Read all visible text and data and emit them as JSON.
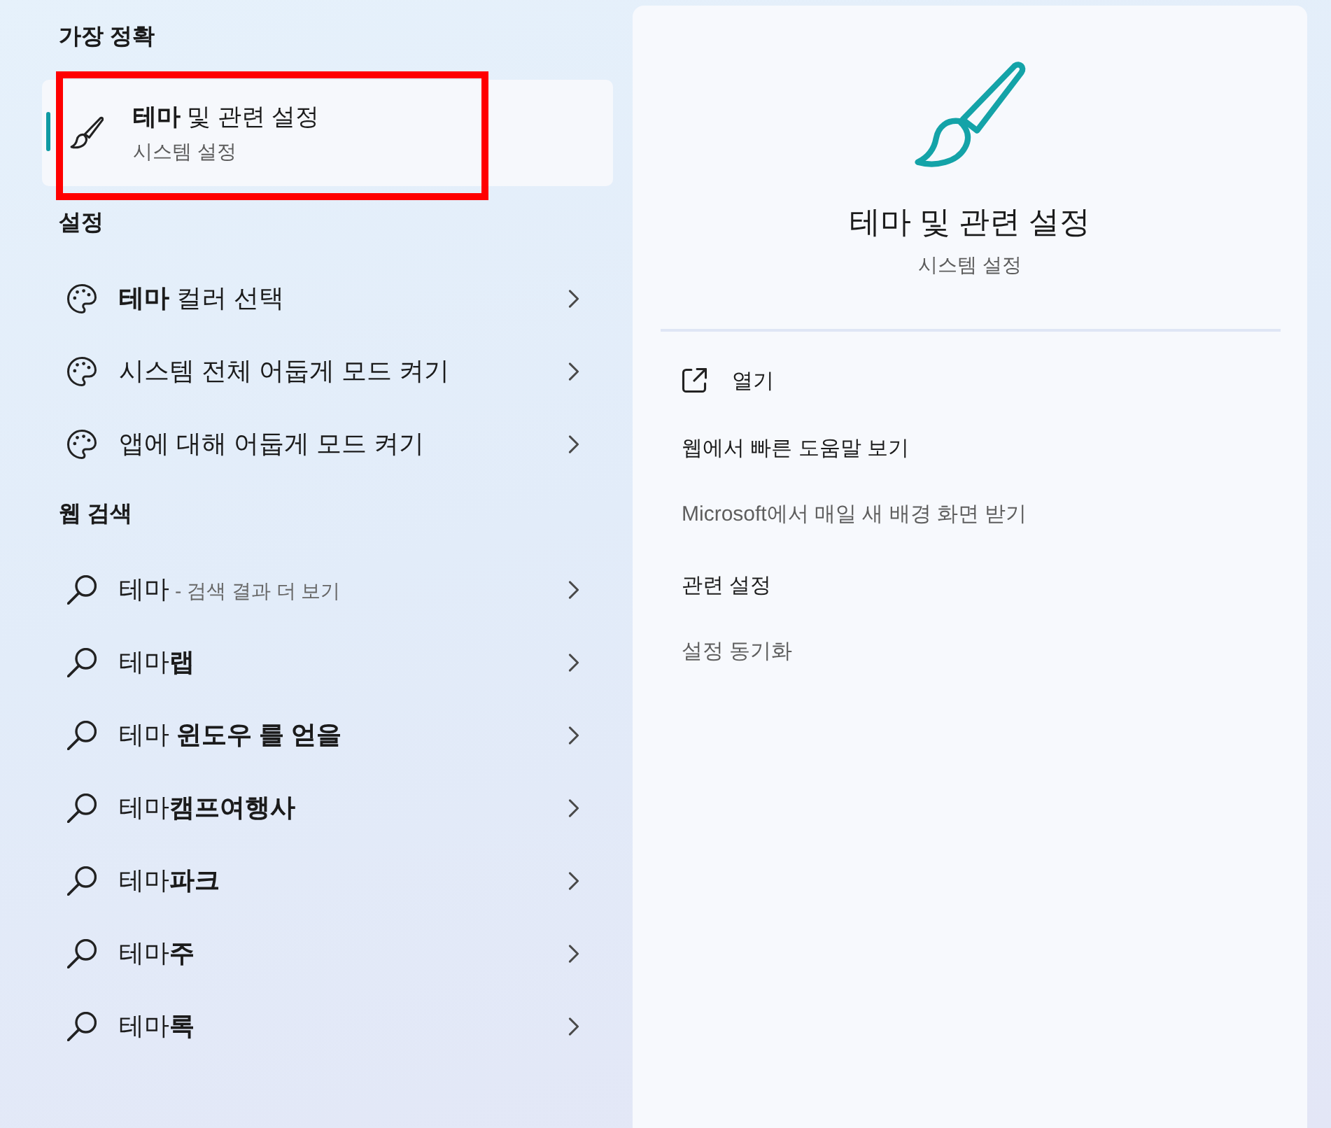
{
  "best_match": {
    "heading": "가장 정확",
    "title": "**테마** 및 관련 설정",
    "subtitle": "시스템 설정",
    "selected": true,
    "outlined": true
  },
  "settings": {
    "heading": "설정",
    "items": [
      {
        "label": "**테마** 컬러 선택"
      },
      {
        "label": "시스템 전체 어둡게 모드 켜기"
      },
      {
        "label": "앱에 대해 어둡게 모드 켜기"
      }
    ]
  },
  "web_search": {
    "heading": "웹 검색",
    "items": [
      {
        "label": "테마",
        "hint": "- 검색 결과 더 보기"
      },
      {
        "label": "테마**랩**"
      },
      {
        "label": "테마 **윈도우 를 얻을**"
      },
      {
        "label": "테마**캠프여행사**"
      },
      {
        "label": "테마**파크**"
      },
      {
        "label": "테마**주**"
      },
      {
        "label": "테마**록**"
      }
    ]
  },
  "detail": {
    "title": "테마 및 관련 설정",
    "subtitle": "시스템 설정",
    "actions": [
      {
        "label": "열기"
      }
    ],
    "sections": [
      {
        "title": "웹에서 빠른 도움말 보기",
        "links": [
          "Microsoft에서 매일 새 배경 화면 받기"
        ]
      },
      {
        "title": "관련 설정",
        "links": [
          "설정 동기화"
        ]
      }
    ]
  }
}
